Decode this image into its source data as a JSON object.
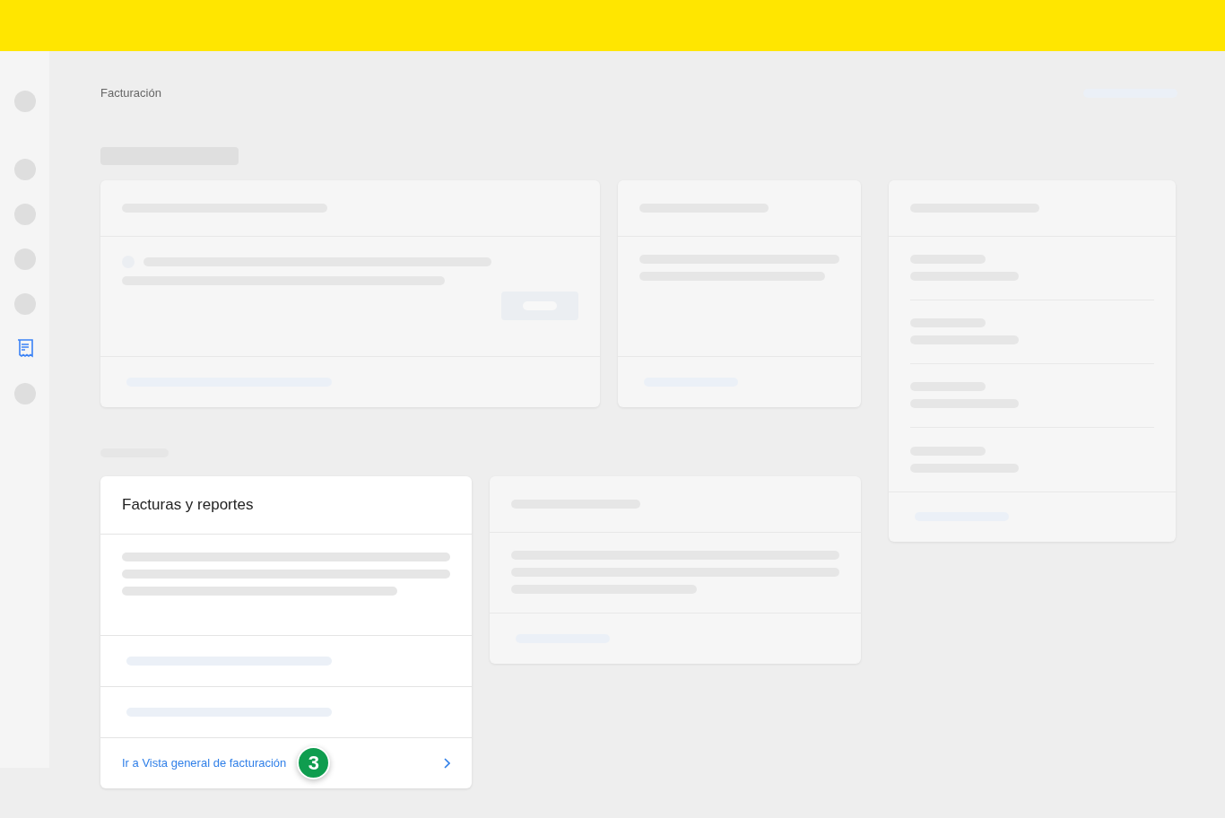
{
  "sidebar": {
    "items": [
      {
        "selected": false
      },
      {
        "selected": false
      },
      {
        "selected": false
      },
      {
        "selected": false
      },
      {
        "selected": false
      },
      {
        "selected": true
      },
      {
        "selected": false
      }
    ]
  },
  "breadcrumb": "Facturación",
  "invoices_card": {
    "title": "Facturas y reportes",
    "link": {
      "label": "Ir a Vista general de facturación",
      "badge": "3"
    }
  }
}
